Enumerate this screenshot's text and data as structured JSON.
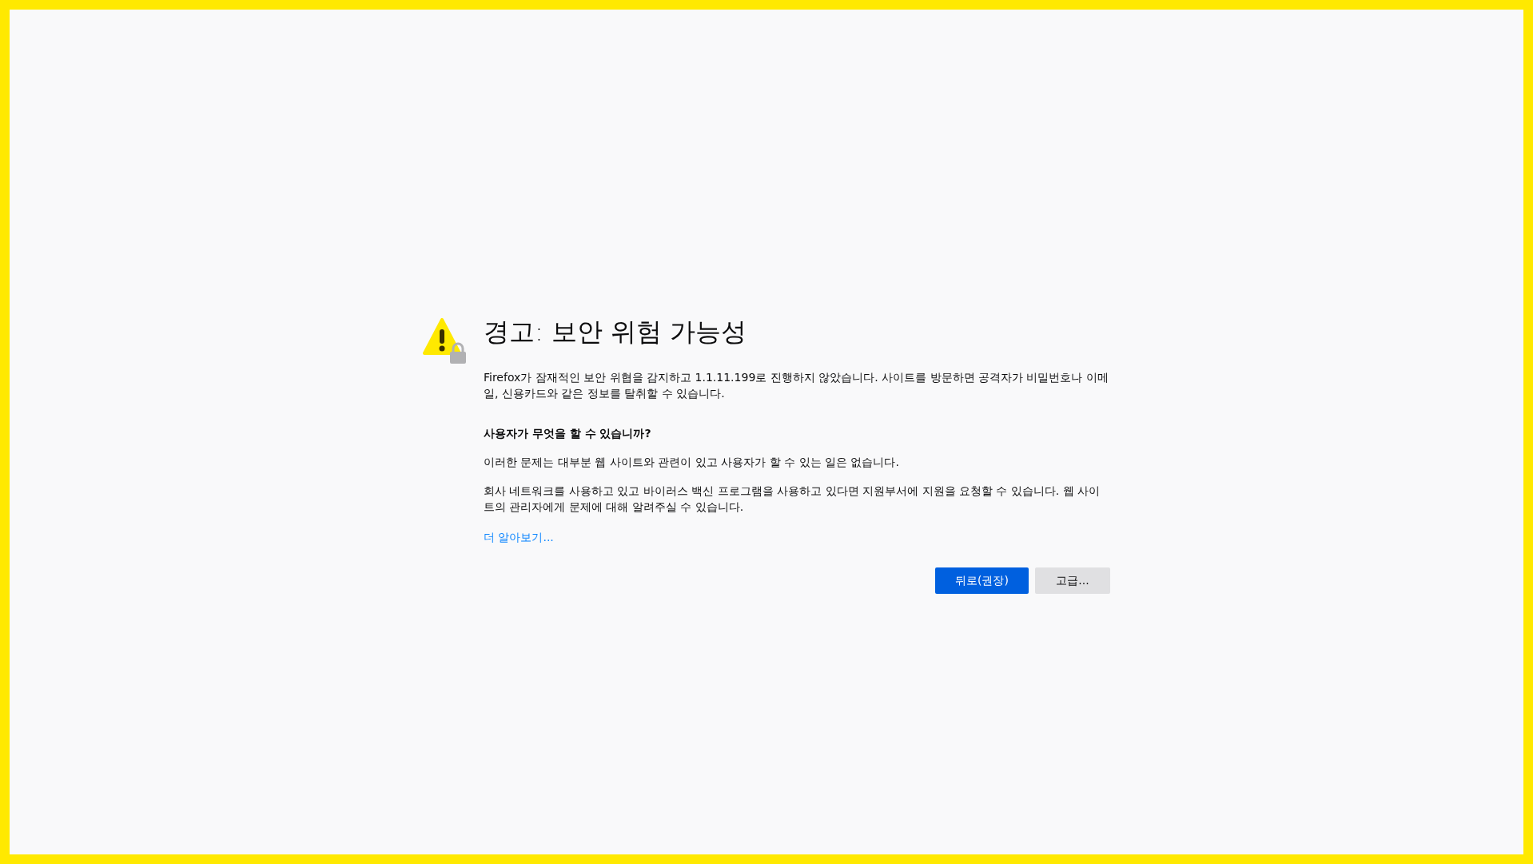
{
  "title": "경고: 보안 위험 가능성",
  "intro": "Firefox가 잠재적인 보안 위협을 감지하고 1.1.11.199로 진행하지 않았습니다. 사이트를 방문하면 공격자가 비밀번호나 이메일, 신용카드와 같은 정보를 탈취할 수 있습니다.",
  "what_to_do": {
    "heading": "사용자가 무엇을 할 수 있습니까?",
    "paragraphs": [
      "이러한 문제는 대부분 웹 사이트와 관련이 있고 사용자가 할 수 있는 일은 없습니다.",
      "회사 네트워크를 사용하고 있고 바이러스 백신 프로그램을 사용하고 있다면 지원부서에 지원을 요청할 수 있습니다. 웹 사이트의 관리자에게 문제에 대해 알려주실 수 있습니다."
    ]
  },
  "learn_more_link": "더 알아보기...",
  "buttons": [
    {
      "label": "뒤로(권장)",
      "kind": "primary"
    },
    {
      "label": "고급...",
      "kind": "secondary"
    }
  ]
}
